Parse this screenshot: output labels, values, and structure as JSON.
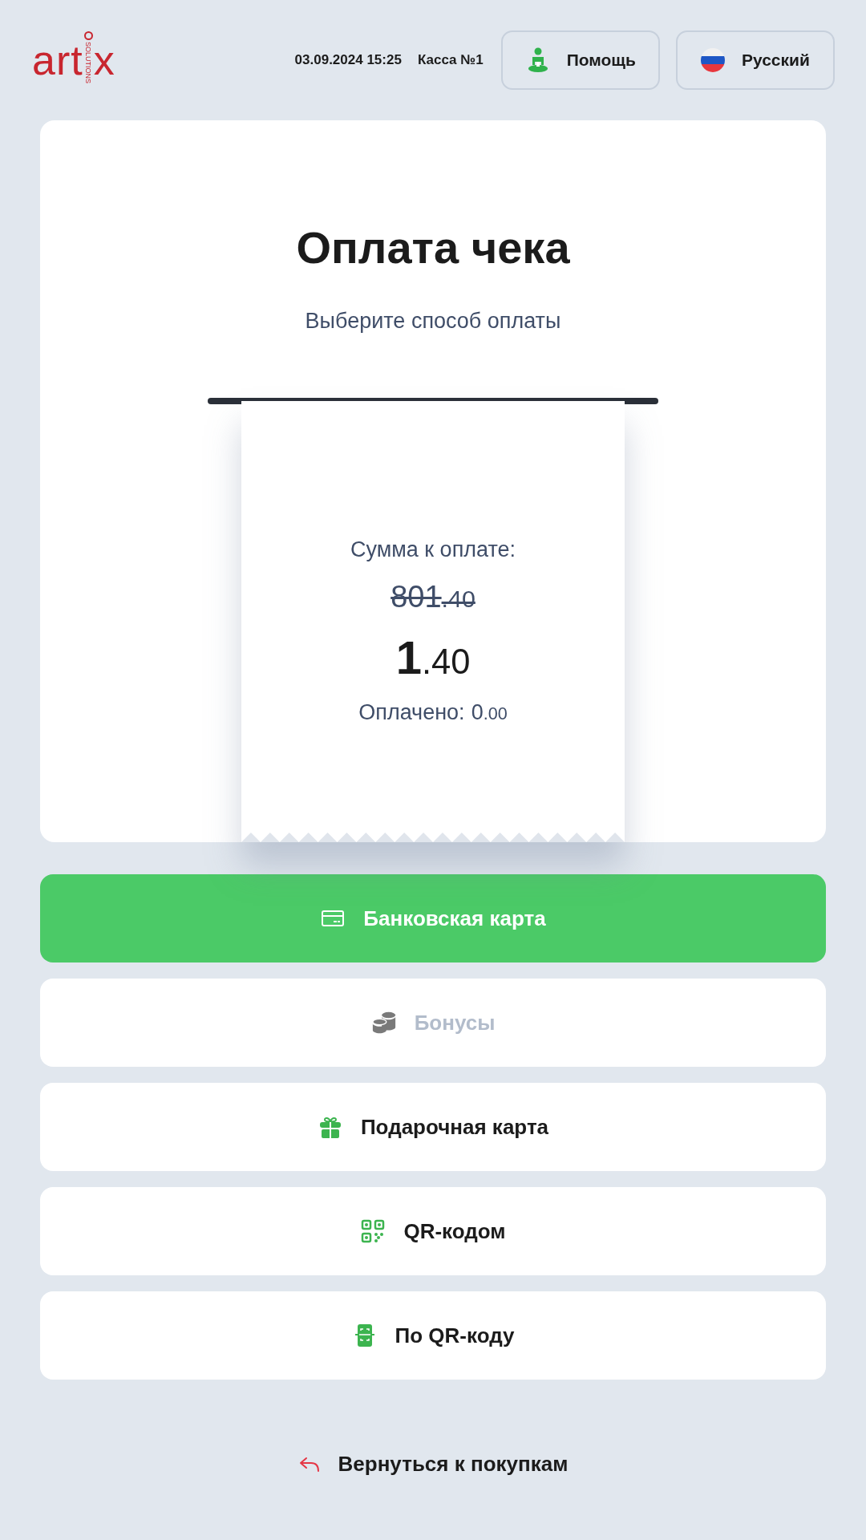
{
  "header": {
    "logo": {
      "main": "art",
      "end": "x",
      "tagline": "SOLUTIONS"
    },
    "datetime": "03.09.2024 15:25",
    "register": "Касса №1",
    "buttons": [
      {
        "kind": "help",
        "label": "Помощь"
      },
      {
        "kind": "language",
        "label": "Русский"
      }
    ]
  },
  "title": "Оплата чека",
  "subtitle": "Выберите способ оплаты",
  "receipt": {
    "label": "Сумма к оплате:",
    "old_amount": {
      "whole": "801",
      "fraction": ".40"
    },
    "amount": {
      "whole": "1",
      "fraction": ".40"
    },
    "paid_label": "Оплачено:",
    "paid": {
      "whole": "0",
      "fraction": ".00"
    }
  },
  "methods": [
    {
      "kind": "card",
      "label": "Банковская карта",
      "selected": true,
      "disabled": false
    },
    {
      "kind": "bonus",
      "label": "Бонусы",
      "selected": false,
      "disabled": true
    },
    {
      "kind": "gift",
      "label": "Подарочная карта",
      "selected": false,
      "disabled": false
    },
    {
      "kind": "qr",
      "label": "QR-кодом",
      "selected": false,
      "disabled": false
    },
    {
      "kind": "scan",
      "label": "По QR-коду",
      "selected": false,
      "disabled": false
    }
  ],
  "back": "Вернуться к покупкам"
}
